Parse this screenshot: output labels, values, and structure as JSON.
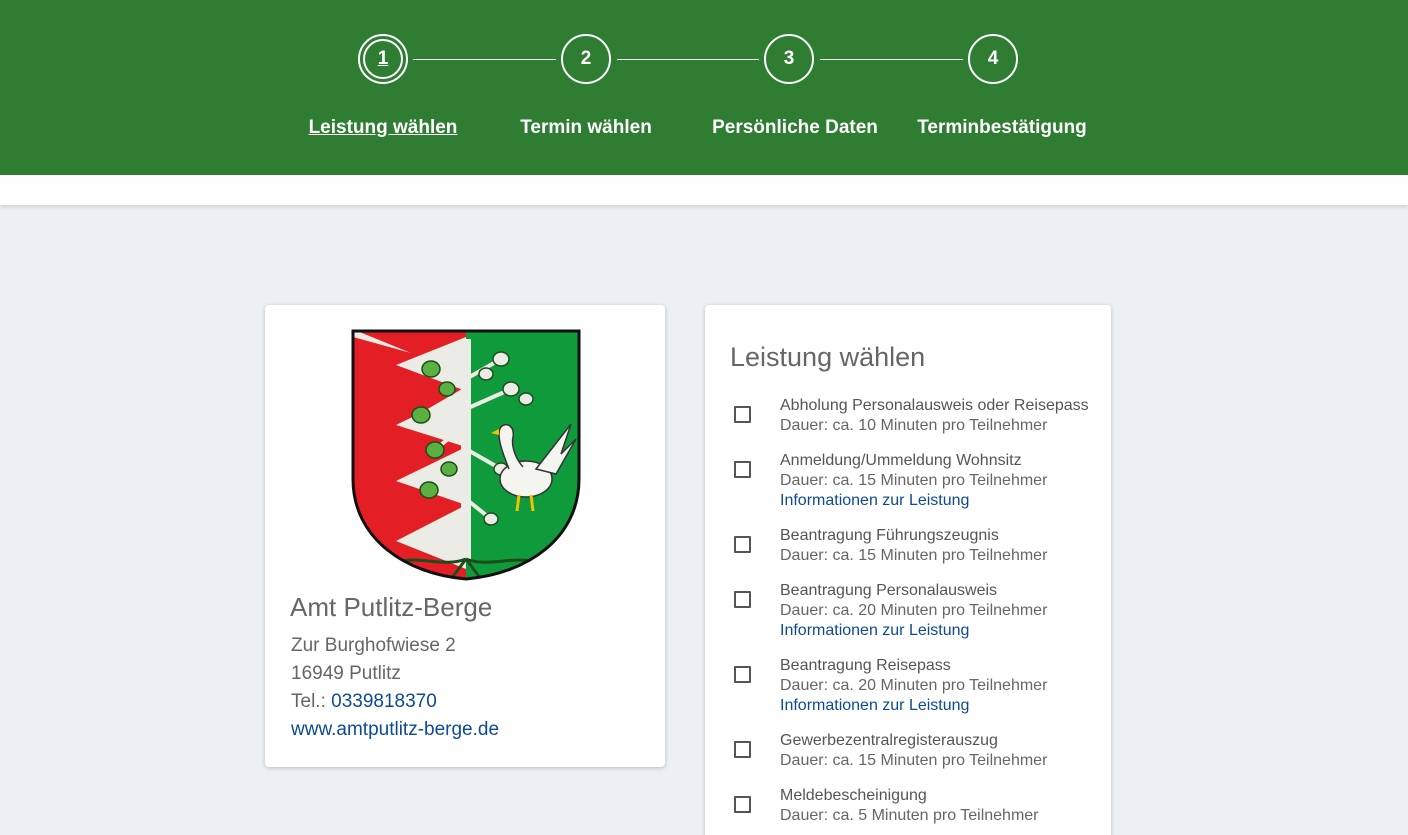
{
  "stepper": {
    "steps": [
      {
        "number": "1",
        "label": "Leistung wählen",
        "active": true
      },
      {
        "number": "2",
        "label": "Termin wählen",
        "active": false
      },
      {
        "number": "3",
        "label": "Persönliche Daten",
        "active": false
      },
      {
        "number": "4",
        "label": "Terminbestätigung",
        "active": false
      }
    ]
  },
  "office": {
    "crest_icon": "coat-of-arms-icon",
    "name": "Amt Putlitz-Berge",
    "street": "Zur Burghofwiese 2",
    "city": "16949 Putlitz",
    "phone_label": "Tel.: ",
    "phone": "0339818370",
    "website": "www.amtputlitz-berge.de"
  },
  "services": {
    "title": "Leistung wählen",
    "items": [
      {
        "name": "Abholung Personalausweis oder Reisepass",
        "duration": "Dauer: ca. 10 Minuten pro Teilnehmer",
        "info": ""
      },
      {
        "name": "Anmeldung/Ummeldung Wohnsitz",
        "duration": "Dauer: ca. 15 Minuten pro Teilnehmer",
        "info": "Informationen zur Leistung"
      },
      {
        "name": "Beantragung Führungszeugnis",
        "duration": "Dauer: ca. 15 Minuten pro Teilnehmer",
        "info": ""
      },
      {
        "name": "Beantragung Personalausweis",
        "duration": "Dauer: ca. 20 Minuten pro Teilnehmer",
        "info": "Informationen zur Leistung"
      },
      {
        "name": "Beantragung Reisepass",
        "duration": "Dauer: ca. 20 Minuten pro Teilnehmer",
        "info": "Informationen zur Leistung"
      },
      {
        "name": "Gewerbezentralregisterauszug",
        "duration": "Dauer: ca. 15 Minuten pro Teilnehmer",
        "info": ""
      },
      {
        "name": "Meldebescheinigung",
        "duration": "Dauer: ca. 5 Minuten pro Teilnehmer",
        "info": ""
      }
    ]
  },
  "colors": {
    "header_green": "#2e7d32",
    "link_blue": "#0d4a96",
    "page_background": "#edf0f2"
  }
}
